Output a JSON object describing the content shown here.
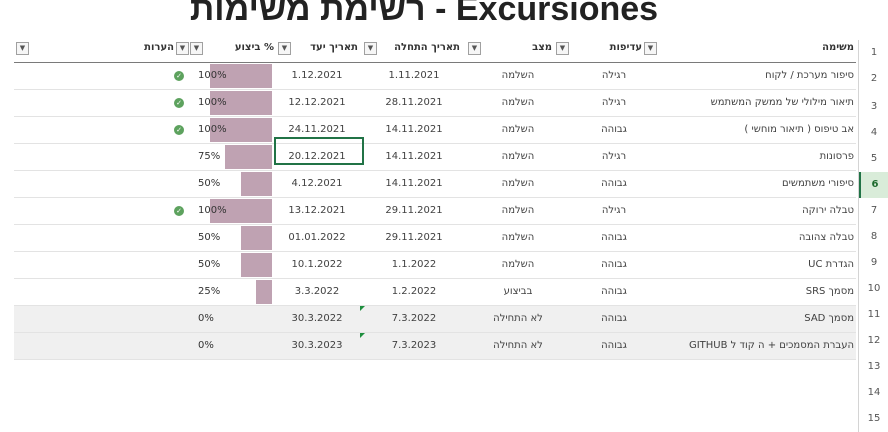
{
  "title": "רשימת משימות - Excursiones",
  "row_numbers": [
    "1",
    "2",
    "3",
    "4",
    "5",
    "6",
    "7",
    "8",
    "9",
    "10",
    "11",
    "12",
    "13",
    "14",
    "15"
  ],
  "active_row": "6",
  "headers": {
    "task": "משימה",
    "priority": "עדיפות",
    "status": "מצב",
    "start_date": "תאריך התחלה",
    "due_date": "תאריך יעד",
    "percent": "% ביצוע",
    "notes": "הערות"
  },
  "rows": [
    {
      "task": "סיפור מערכת / לקוח",
      "priority": "רגילה",
      "status": "השלמה",
      "start": "1.11.2021",
      "due": "1.12.2021",
      "pct": "100%",
      "pct_value": 1.0,
      "done": true
    },
    {
      "task": "תיאור מילולי של ממשק המשתמש",
      "priority": "רגילה",
      "status": "השלמה",
      "start": "28.11.2021",
      "due": "12.12.2021",
      "pct": "100%",
      "pct_value": 1.0,
      "done": true
    },
    {
      "task": "אב טיפוס ( תיאור מוחשי )",
      "priority": "גבוהה",
      "status": "השלמה",
      "start": "14.11.2021",
      "due": "24.11.2021",
      "pct": "100%",
      "pct_value": 1.0,
      "done": true
    },
    {
      "task": "פרסונות",
      "priority": "רגילה",
      "status": "השלמה",
      "start": "14.11.2021",
      "due": "20.12.2021",
      "pct": "75%",
      "pct_value": 0.75,
      "done": false
    },
    {
      "task": "סיפורי משתמשים",
      "priority": "גבוהה",
      "status": "השלמה",
      "start": "14.11.2021",
      "due": "4.12.2021",
      "pct": "50%",
      "pct_value": 0.5,
      "done": false
    },
    {
      "task": "טבלה ירוקה",
      "priority": "רגילה",
      "status": "השלמה",
      "start": "29.11.2021",
      "due": "13.12.2021",
      "pct": "100%",
      "pct_value": 1.0,
      "done": true
    },
    {
      "task": "טבלה צהובה",
      "priority": "גבוהה",
      "status": "השלמה",
      "start": "29.11.2021",
      "due": "01.01.2022",
      "pct": "50%",
      "pct_value": 0.5,
      "done": false
    },
    {
      "task": "הגדרת UC",
      "priority": "גבוהה",
      "status": "השלמה",
      "start": "1.1.2022",
      "due": "10.1.2022",
      "pct": "50%",
      "pct_value": 0.5,
      "done": false
    },
    {
      "task": "מסמך SRS",
      "priority": "גבוהה",
      "status": "בביצוע",
      "start": "1.2.2022",
      "due": "3.3.2022",
      "pct": "25%",
      "pct_value": 0.25,
      "done": false
    },
    {
      "task": "מסמך SAD",
      "priority": "גבוהה",
      "status": "לא התחילה",
      "start": "7.3.2022",
      "due": "30.3.2022",
      "pct": "0%",
      "pct_value": 0,
      "done": false
    },
    {
      "task": "העברת המסמכים + ה קוד ל GITHUB",
      "priority": "גבוהה",
      "status": "לא התחילה",
      "start": "7.3.2023",
      "due": "30.3.2023",
      "pct": "0%",
      "pct_value": 0,
      "done": false
    }
  ],
  "colors": {
    "bar": "#bfa2b2",
    "check": "#5da25e",
    "selection": "#217346"
  }
}
